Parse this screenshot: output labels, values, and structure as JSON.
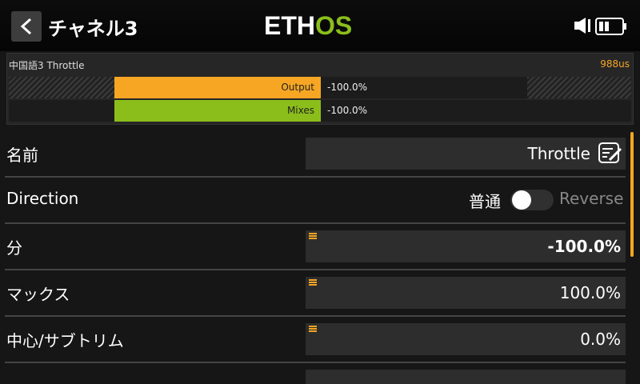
{
  "header": {
    "title": "チャネル3",
    "logo_left": "ETH",
    "logo_right": "OS"
  },
  "monitor": {
    "channel_label": "中国語3  Throttle",
    "pulse": "988us",
    "bars": [
      {
        "label": "Output",
        "value": "-100.0%",
        "color": "#f6a623"
      },
      {
        "label": "Mixes",
        "value": "-100.0%",
        "color": "#8bbe1b"
      }
    ]
  },
  "fields": {
    "name": {
      "label": "名前",
      "value": "Throttle"
    },
    "direction": {
      "label": "Direction",
      "normal": "普通",
      "reverse": "Reverse",
      "reversed": false
    },
    "min": {
      "label": "分",
      "value": "-100.0%"
    },
    "max": {
      "label": "マックス",
      "value": "100.0%"
    },
    "center": {
      "label": "中心/サブトリム",
      "value": "0.0%"
    }
  },
  "colors": {
    "accent": "#f6a623",
    "green": "#8bbe1b"
  }
}
